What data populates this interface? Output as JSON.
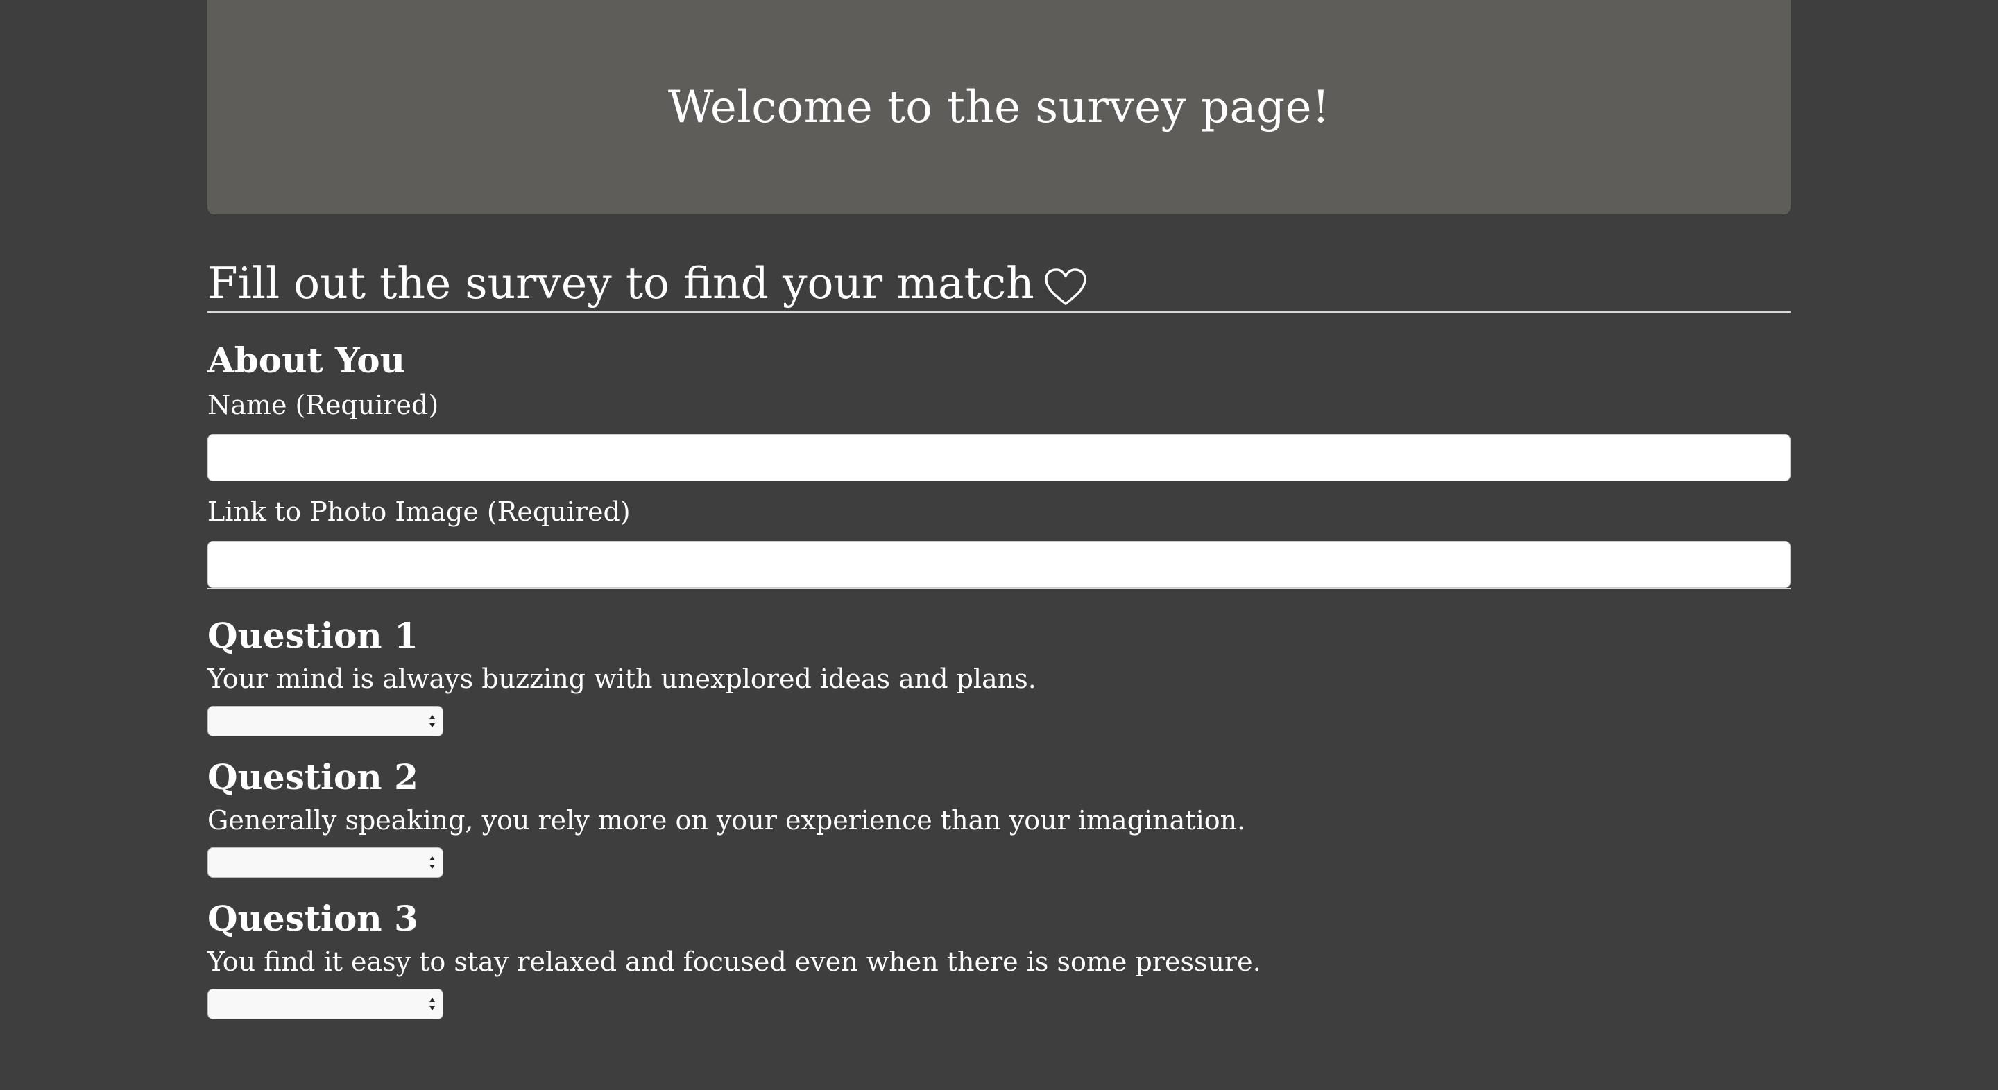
{
  "header": {
    "title": "Welcome to the survey page!"
  },
  "survey": {
    "subtitle": "Fill out the survey to find your match",
    "about_heading": "About You",
    "name_label": "Name (Required)",
    "name_value": "",
    "photo_label": "Link to Photo Image (Required)",
    "photo_value": ""
  },
  "questions": [
    {
      "heading": "Question 1",
      "text": "Your mind is always buzzing with unexplored ideas and plans.",
      "selected": ""
    },
    {
      "heading": "Question 2",
      "text": "Generally speaking, you rely more on your experience than your imagination.",
      "selected": ""
    },
    {
      "heading": "Question 3",
      "text": "You find it easy to stay relaxed and focused even when there is some pressure.",
      "selected": ""
    }
  ],
  "icons": {
    "subtitle_icon": "heart-icon",
    "select_icon": "select-arrows-icon"
  },
  "colors": {
    "page_background": "#3e3e3e",
    "jumbotron_background": "#5e5d5a",
    "text": "#ffffff"
  }
}
